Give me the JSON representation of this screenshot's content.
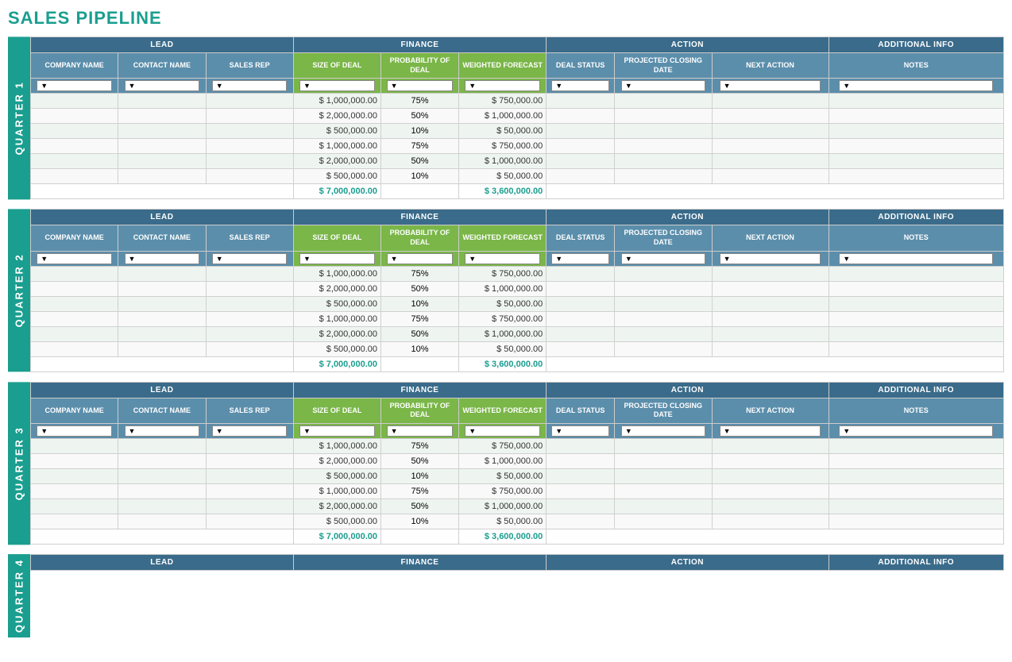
{
  "title": "SALES PIPELINE",
  "columns": {
    "lead_group": "LEAD",
    "finance_group": "FINANCE",
    "action_group": "ACTION",
    "additional_group": "ADDITIONAL INFO",
    "company_name": "COMPANY NAME",
    "contact_name": "CONTACT NAME",
    "sales_rep": "SALES REP",
    "size_of_deal": "SIZE OF DEAL",
    "probability_of_deal": "PROBABILITY OF DEAL",
    "weighted_forecast": "WEIGHTED FORECAST",
    "deal_status": "DEAL STATUS",
    "projected_closing_date": "PROJECTED CLOSING DATE",
    "next_action": "NEXT ACTION",
    "notes": "NOTES"
  },
  "quarters": [
    {
      "label": "QUARTER 1",
      "rows": [
        {
          "size": "$ 1,000,000.00",
          "prob": "75%",
          "weighted": "$ 750,000.00"
        },
        {
          "size": "$ 2,000,000.00",
          "prob": "50%",
          "weighted": "$ 1,000,000.00"
        },
        {
          "size": "$ 500,000.00",
          "prob": "10%",
          "weighted": "$ 50,000.00"
        },
        {
          "size": "$ 1,000,000.00",
          "prob": "75%",
          "weighted": "$ 750,000.00"
        },
        {
          "size": "$ 2,000,000.00",
          "prob": "50%",
          "weighted": "$ 1,000,000.00"
        },
        {
          "size": "$ 500,000.00",
          "prob": "10%",
          "weighted": "$ 50,000.00"
        }
      ],
      "total_size": "$ 7,000,000.00",
      "total_weighted": "$ 3,600,000.00"
    },
    {
      "label": "QUARTER 2",
      "rows": [
        {
          "size": "$ 1,000,000.00",
          "prob": "75%",
          "weighted": "$ 750,000.00"
        },
        {
          "size": "$ 2,000,000.00",
          "prob": "50%",
          "weighted": "$ 1,000,000.00"
        },
        {
          "size": "$ 500,000.00",
          "prob": "10%",
          "weighted": "$ 50,000.00"
        },
        {
          "size": "$ 1,000,000.00",
          "prob": "75%",
          "weighted": "$ 750,000.00"
        },
        {
          "size": "$ 2,000,000.00",
          "prob": "50%",
          "weighted": "$ 1,000,000.00"
        },
        {
          "size": "$ 500,000.00",
          "prob": "10%",
          "weighted": "$ 50,000.00"
        }
      ],
      "total_size": "$ 7,000,000.00",
      "total_weighted": "$ 3,600,000.00"
    },
    {
      "label": "QUARTER 3",
      "rows": [
        {
          "size": "$ 1,000,000.00",
          "prob": "75%",
          "weighted": "$ 750,000.00"
        },
        {
          "size": "$ 2,000,000.00",
          "prob": "50%",
          "weighted": "$ 1,000,000.00"
        },
        {
          "size": "$ 500,000.00",
          "prob": "10%",
          "weighted": "$ 50,000.00"
        },
        {
          "size": "$ 1,000,000.00",
          "prob": "75%",
          "weighted": "$ 750,000.00"
        },
        {
          "size": "$ 2,000,000.00",
          "prob": "50%",
          "weighted": "$ 1,000,000.00"
        },
        {
          "size": "$ 500,000.00",
          "prob": "10%",
          "weighted": "$ 50,000.00"
        }
      ],
      "total_size": "$ 7,000,000.00",
      "total_weighted": "$ 3,600,000.00"
    }
  ],
  "partial_quarter_label": "QUARTER 4",
  "colors": {
    "teal": "#1a9e8f",
    "dark_blue": "#3a6b8a",
    "mid_blue": "#5b8eab",
    "green": "#7ab648",
    "light_green_row": "#eef5f0",
    "white_row": "#f9f9f9"
  }
}
